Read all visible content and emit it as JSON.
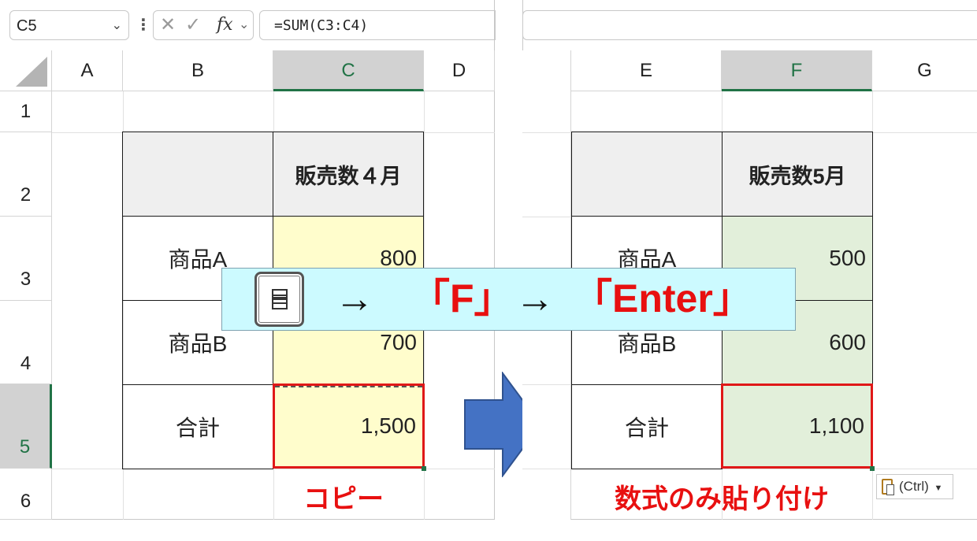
{
  "toolbar": {
    "namebox": "C5",
    "formula": "=SUM(C3:C4)",
    "cancel_glyph": "✕",
    "enter_glyph": "✓",
    "fx_label": "fx"
  },
  "left_sheet": {
    "columns": [
      "A",
      "B",
      "C",
      "D"
    ],
    "rows": [
      "1",
      "2",
      "3",
      "4",
      "5",
      "6"
    ],
    "table": {
      "header": "販売数４月",
      "products": [
        "商品A",
        "商品B",
        "合計"
      ],
      "values": [
        "800",
        "700",
        "1,500"
      ]
    },
    "caption": "コピー"
  },
  "right_sheet": {
    "columns": [
      "E",
      "F",
      "G"
    ],
    "table": {
      "header": "販売数5月",
      "products": [
        "商品A",
        "商品B",
        "合計"
      ],
      "values": [
        "500",
        "600",
        "1,100"
      ]
    },
    "caption": "数式のみ貼り付け",
    "paste_options": "(Ctrl)"
  },
  "overlay": {
    "arrow1": "→",
    "key_f": "「F」",
    "arrow2": "→",
    "key_enter": "「Enter」"
  },
  "colors": {
    "accent_green": "#217346",
    "selection_red": "#e01818",
    "copy_fill": "#fffdcc",
    "paste_fill": "#e2efda",
    "overlay_fill": "#ccfaff",
    "arrow_blue": "#4472c4"
  }
}
